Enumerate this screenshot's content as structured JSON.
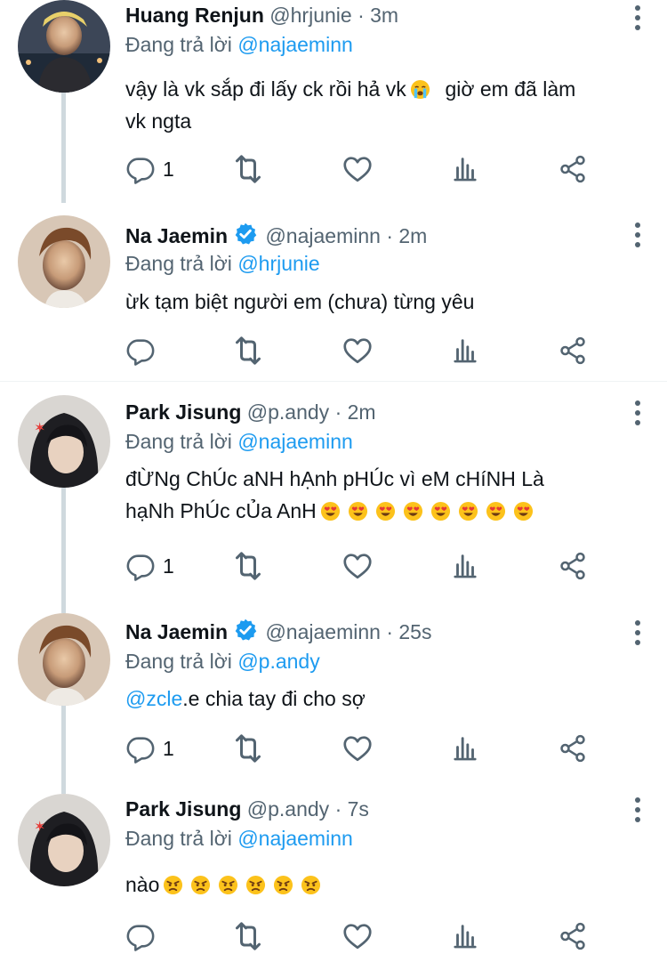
{
  "reply_prefix": "Đang trả lời",
  "tweets": [
    {
      "name": "Huang Renjun",
      "handle": "@hrjunie",
      "dot": "·",
      "time": "3m",
      "reply_to": "@najaeminn",
      "text_before_emoji": "vậy là vk sắp đi lấy ck rồi hả vk",
      "text_after_emoji": "  giờ em đã làm\nvk ngta",
      "reply_count": "1"
    },
    {
      "name": "Na Jaemin",
      "handle": "@najaeminn",
      "dot": "·",
      "time": "2m",
      "reply_to": "@hrjunie",
      "text": "ừk tạm biệt người em (chưa) từng yêu",
      "reply_count": ""
    },
    {
      "name": "Park Jisung",
      "handle": "@p.andy",
      "dot": "·",
      "time": "2m",
      "reply_to": "@najaeminn",
      "text_line1": "đỪNg ChÚc aNH hẠnh pHÚc vì eM cHíNH Là",
      "text_line2": "hạNh PhÚc cỦa AnH",
      "reply_count": "1"
    },
    {
      "name": "Na Jaemin",
      "handle": "@najaeminn",
      "dot": "·",
      "time": "25s",
      "reply_to": "@p.andy",
      "mention": "@zcle",
      "text": ".e chia tay đi cho sợ",
      "reply_count": "1"
    },
    {
      "name": "Park Jisung",
      "handle": "@p.andy",
      "dot": "·",
      "time": "7s",
      "reply_to": "@najaeminn",
      "text": "nào",
      "reply_count": ""
    }
  ],
  "icons": {
    "reply": "reply-icon",
    "retweet": "retweet-icon",
    "like": "heart-icon",
    "views": "analytics-icon",
    "share": "share-icon",
    "more": "more-icon",
    "verified": "verified-badge-icon"
  },
  "colors": {
    "link": "#1d9bf0",
    "secondary": "#536471",
    "text": "#0f1419",
    "thread_line": "#cfd9de"
  }
}
